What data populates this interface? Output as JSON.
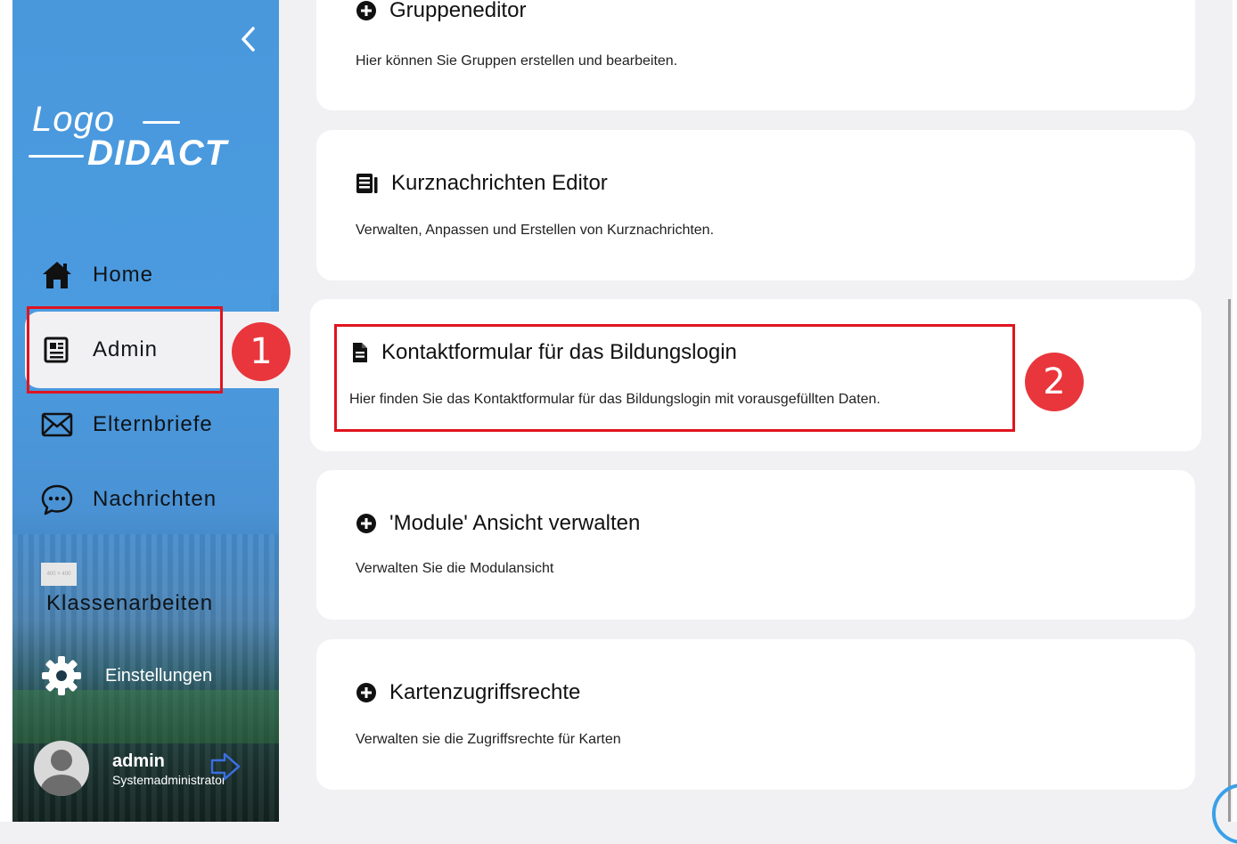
{
  "sidebar": {
    "logo_line1": "Logo",
    "logo_line2": "DIDACT",
    "items": [
      {
        "label": "Home"
      },
      {
        "label": "Admin"
      },
      {
        "label": "Elternbriefe"
      },
      {
        "label": "Nachrichten"
      },
      {
        "label": "Klassenarbeiten"
      }
    ],
    "placeholder_text": "400 × 400",
    "settings_label": "Einstellungen",
    "user": {
      "name": "admin",
      "role": "Systemadministrator"
    }
  },
  "cards": [
    {
      "title": "Gruppeneditor",
      "description": "Hier können Sie Gruppen erstellen und bearbeiten.",
      "icon": "plus-circle-icon"
    },
    {
      "title": "Kurznachrichten Editor",
      "description": "Verwalten, Anpassen und Erstellen von Kurznachrichten.",
      "icon": "newspaper-icon"
    },
    {
      "title": "Kontaktformular für das Bildungslogin",
      "description": "Hier finden Sie das Kontaktformular für das Bildungslogin mit vorausgefüllten Daten.",
      "icon": "document-icon"
    },
    {
      "title": "'Module' Ansicht verwalten",
      "description": "Verwalten Sie die Modulansicht",
      "icon": "plus-circle-icon"
    },
    {
      "title": "Kartenzugriffsrechte",
      "description": "Verwalten sie die Zugriffsrechte für Karten",
      "icon": "plus-circle-icon"
    }
  ],
  "annotations": {
    "badge1": "1",
    "badge2": "2"
  },
  "colors": {
    "sidebar_blue": "#4a98dc",
    "highlight_red": "#e0141e",
    "badge_red": "#e8363c",
    "page_bg": "#f1f1f3"
  }
}
